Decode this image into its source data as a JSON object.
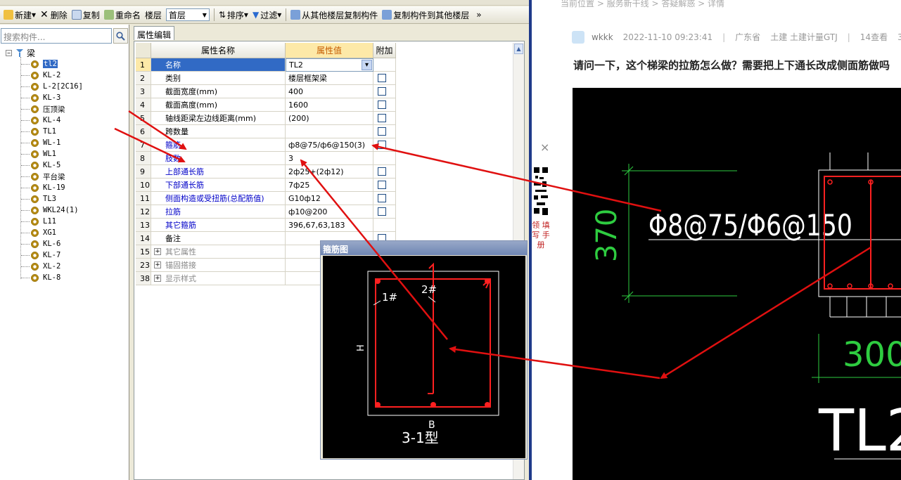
{
  "toolbar": {
    "new": "新建",
    "delete": "删除",
    "copy": "复制",
    "rename": "重命名",
    "floor_label": "楼层",
    "floor_value": "首层",
    "sort": "排序",
    "filter": "过滤",
    "copy_from_floor": "从其他楼层复制构件",
    "copy_to_floor": "复制构件到其他楼层",
    "more": "»"
  },
  "search": {
    "placeholder": "搜索构件..."
  },
  "tree": {
    "root": "梁",
    "items": [
      "tl2",
      "KL-2",
      "L-2[2C16]",
      "KL-3",
      "压顶梁",
      "KL-4",
      "TL1",
      "WL-1",
      "WL1",
      "KL-5",
      "平台梁",
      "KL-19",
      "TL3",
      "WKL24(1)",
      "L11",
      "XG1",
      "KL-6",
      "KL-7",
      "XL-2",
      "KL-8"
    ],
    "selected": "tl2"
  },
  "tab": {
    "label": "属性编辑"
  },
  "grid": {
    "headers": {
      "name": "属性名称",
      "value": "属性值",
      "extra": "附加"
    },
    "rows": [
      {
        "num": "1",
        "name": "名称",
        "value": "TL2",
        "check": false,
        "style": "blue"
      },
      {
        "num": "2",
        "name": "类别",
        "value": "楼层框架梁",
        "check": true,
        "style": "black"
      },
      {
        "num": "3",
        "name": "截面宽度(mm)",
        "value": "400",
        "check": true,
        "style": "black"
      },
      {
        "num": "4",
        "name": "截面高度(mm)",
        "value": "1600",
        "check": true,
        "style": "black"
      },
      {
        "num": "5",
        "name": "轴线距梁左边线距离(mm)",
        "value": "(200)",
        "check": true,
        "style": "black"
      },
      {
        "num": "6",
        "name": "跨数量",
        "value": "",
        "check": true,
        "style": "black"
      },
      {
        "num": "7",
        "name": "箍筋",
        "value": "ф8@75/ф6@150(3)",
        "check": true,
        "style": "blue"
      },
      {
        "num": "8",
        "name": "肢数",
        "value": "3",
        "check": false,
        "style": "blue"
      },
      {
        "num": "9",
        "name": "上部通长筋",
        "value": "2ф25+(2ф12)",
        "check": true,
        "style": "blue"
      },
      {
        "num": "10",
        "name": "下部通长筋",
        "value": "7ф25",
        "check": true,
        "style": "blue"
      },
      {
        "num": "11",
        "name": "侧面构造或受扭筋(总配筋值)",
        "value": "G10ф12",
        "check": true,
        "style": "blue"
      },
      {
        "num": "12",
        "name": "拉筋",
        "value": "ф10@200",
        "check": true,
        "style": "blue"
      },
      {
        "num": "13",
        "name": "其它箍筋",
        "value": "396,67,63,183",
        "check": false,
        "style": "blue"
      },
      {
        "num": "14",
        "name": "备注",
        "value": "",
        "check": true,
        "style": "black"
      },
      {
        "num": "15",
        "name": "其它属性",
        "value": "",
        "check": false,
        "style": "gray",
        "expand": true
      },
      {
        "num": "23",
        "name": "锚固搭接",
        "value": "",
        "check": false,
        "style": "gray",
        "expand": true
      },
      {
        "num": "38",
        "name": "显示样式",
        "value": "",
        "check": false,
        "style": "gray",
        "expand": true
      }
    ]
  },
  "stirrup_panel": {
    "title": "箍筋图",
    "label_1": "1#",
    "label_2": "2#",
    "label_h": "H",
    "label_b": "B",
    "type": "3-1型"
  },
  "side": {
    "close": "×",
    "text": "领 填写 手册"
  },
  "post": {
    "breadcrumb": "当前位置 > 服务新干线 > 答疑解惑 > 详情",
    "author": "wkkk",
    "date": "2022-11-10 09:23:41",
    "region": "广东省",
    "tags": "土建 土建计量GTJ",
    "views": "14查看",
    "replies": "3回",
    "title": "请问一下，这个梯梁的拉筋怎么做？需要把上下通长改成侧面筋做吗"
  },
  "cad": {
    "dim_370": "370",
    "rebar_text": "Φ8@75/Φ6@150",
    "dim_300": "300",
    "beam_label": "TL2"
  },
  "colors": {
    "arrow": "#e01010",
    "selected_row": "#316ac5",
    "header_value": "#fde9a8",
    "cad_green": "#2ecc40"
  }
}
